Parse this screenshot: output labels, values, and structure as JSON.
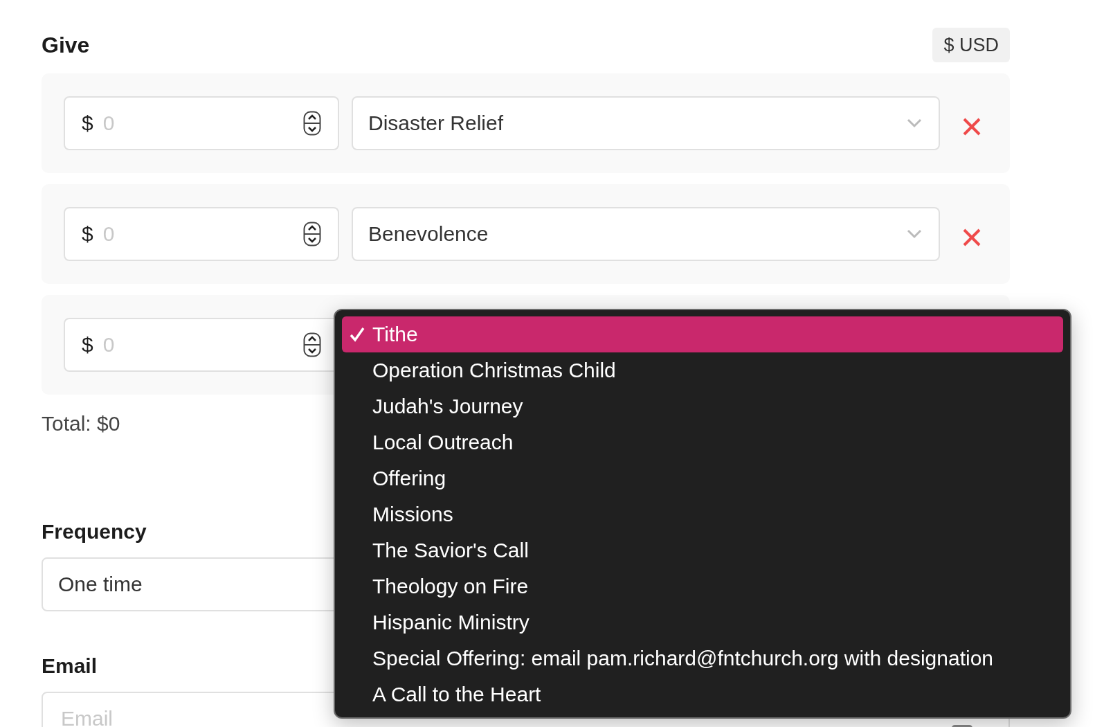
{
  "header": {
    "title": "Give",
    "currency": "$ USD"
  },
  "gifts": [
    {
      "currency_symbol": "$",
      "placeholder": "0",
      "fund": "Disaster Relief"
    },
    {
      "currency_symbol": "$",
      "placeholder": "0",
      "fund": "Benevolence"
    },
    {
      "currency_symbol": "$",
      "placeholder": "0"
    }
  ],
  "total": "Total: $0",
  "frequency": {
    "label": "Frequency",
    "value": "One time"
  },
  "email": {
    "label": "Email",
    "placeholder": "Email"
  },
  "fund_menu": {
    "options": [
      {
        "label": "Tithe",
        "selected": true
      },
      {
        "label": "Operation Christmas Child",
        "selected": false
      },
      {
        "label": "Judah's Journey",
        "selected": false
      },
      {
        "label": "Local Outreach",
        "selected": false
      },
      {
        "label": "Offering",
        "selected": false
      },
      {
        "label": "Missions",
        "selected": false
      },
      {
        "label": "The Savior's Call",
        "selected": false
      },
      {
        "label": "Theology on Fire",
        "selected": false
      },
      {
        "label": "Hispanic Ministry",
        "selected": false
      },
      {
        "label": "Special Offering: email pam.richard@fntchurch.org with designation",
        "selected": false
      },
      {
        "label": "A Call to the Heart",
        "selected": false
      }
    ]
  }
}
